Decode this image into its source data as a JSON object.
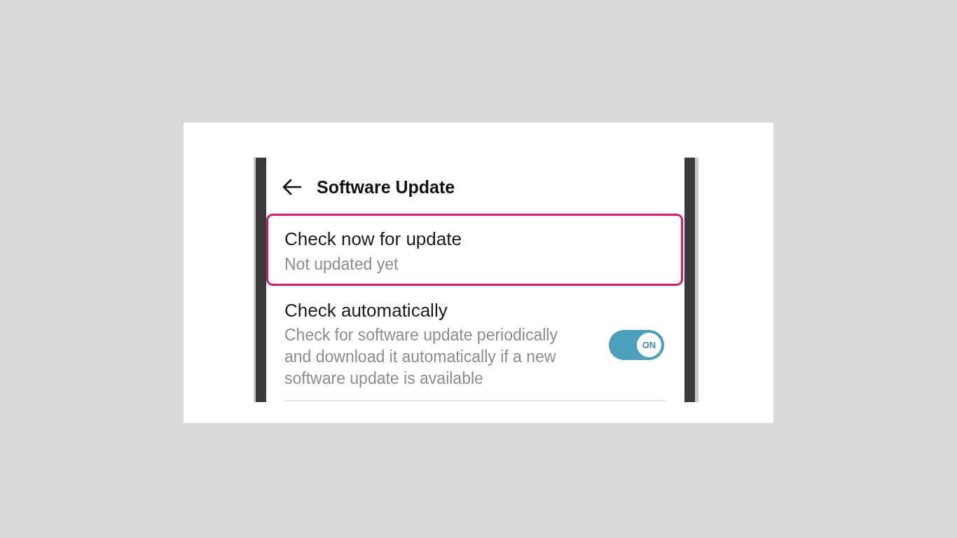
{
  "header": {
    "title": "Software Update"
  },
  "settings": [
    {
      "kind": "action",
      "title": "Check now for update",
      "summary": "Not updated yet",
      "highlighted": true
    },
    {
      "kind": "toggle",
      "title": "Check automatically",
      "summary": "Check for software update periodically and download it automatically if a new software update is available",
      "highlighted": false,
      "toggle": {
        "on": true,
        "label": "ON"
      }
    }
  ]
}
